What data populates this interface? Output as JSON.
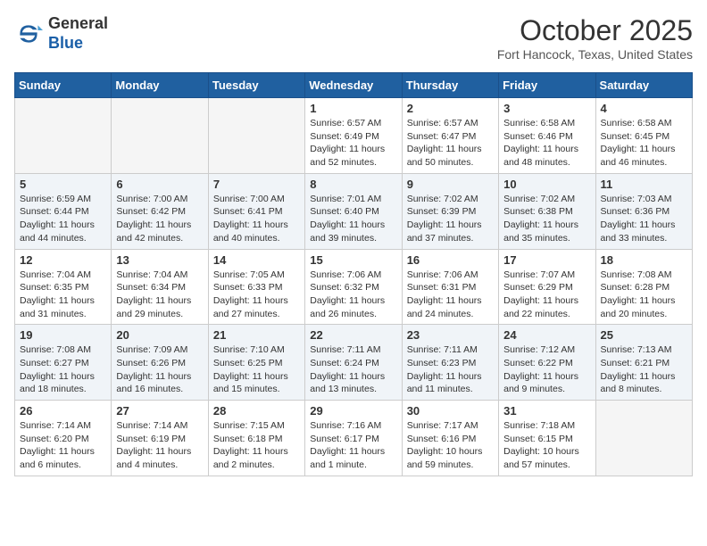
{
  "header": {
    "logo_line1": "General",
    "logo_line2": "Blue",
    "month": "October 2025",
    "location": "Fort Hancock, Texas, United States"
  },
  "weekdays": [
    "Sunday",
    "Monday",
    "Tuesday",
    "Wednesday",
    "Thursday",
    "Friday",
    "Saturday"
  ],
  "weeks": [
    [
      {
        "num": "",
        "sunrise": "",
        "sunset": "",
        "daylight": "",
        "empty": true
      },
      {
        "num": "",
        "sunrise": "",
        "sunset": "",
        "daylight": "",
        "empty": true
      },
      {
        "num": "",
        "sunrise": "",
        "sunset": "",
        "daylight": "",
        "empty": true
      },
      {
        "num": "1",
        "sunrise": "Sunrise: 6:57 AM",
        "sunset": "Sunset: 6:49 PM",
        "daylight": "Daylight: 11 hours and 52 minutes."
      },
      {
        "num": "2",
        "sunrise": "Sunrise: 6:57 AM",
        "sunset": "Sunset: 6:47 PM",
        "daylight": "Daylight: 11 hours and 50 minutes."
      },
      {
        "num": "3",
        "sunrise": "Sunrise: 6:58 AM",
        "sunset": "Sunset: 6:46 PM",
        "daylight": "Daylight: 11 hours and 48 minutes."
      },
      {
        "num": "4",
        "sunrise": "Sunrise: 6:58 AM",
        "sunset": "Sunset: 6:45 PM",
        "daylight": "Daylight: 11 hours and 46 minutes."
      }
    ],
    [
      {
        "num": "5",
        "sunrise": "Sunrise: 6:59 AM",
        "sunset": "Sunset: 6:44 PM",
        "daylight": "Daylight: 11 hours and 44 minutes."
      },
      {
        "num": "6",
        "sunrise": "Sunrise: 7:00 AM",
        "sunset": "Sunset: 6:42 PM",
        "daylight": "Daylight: 11 hours and 42 minutes."
      },
      {
        "num": "7",
        "sunrise": "Sunrise: 7:00 AM",
        "sunset": "Sunset: 6:41 PM",
        "daylight": "Daylight: 11 hours and 40 minutes."
      },
      {
        "num": "8",
        "sunrise": "Sunrise: 7:01 AM",
        "sunset": "Sunset: 6:40 PM",
        "daylight": "Daylight: 11 hours and 39 minutes."
      },
      {
        "num": "9",
        "sunrise": "Sunrise: 7:02 AM",
        "sunset": "Sunset: 6:39 PM",
        "daylight": "Daylight: 11 hours and 37 minutes."
      },
      {
        "num": "10",
        "sunrise": "Sunrise: 7:02 AM",
        "sunset": "Sunset: 6:38 PM",
        "daylight": "Daylight: 11 hours and 35 minutes."
      },
      {
        "num": "11",
        "sunrise": "Sunrise: 7:03 AM",
        "sunset": "Sunset: 6:36 PM",
        "daylight": "Daylight: 11 hours and 33 minutes."
      }
    ],
    [
      {
        "num": "12",
        "sunrise": "Sunrise: 7:04 AM",
        "sunset": "Sunset: 6:35 PM",
        "daylight": "Daylight: 11 hours and 31 minutes."
      },
      {
        "num": "13",
        "sunrise": "Sunrise: 7:04 AM",
        "sunset": "Sunset: 6:34 PM",
        "daylight": "Daylight: 11 hours and 29 minutes."
      },
      {
        "num": "14",
        "sunrise": "Sunrise: 7:05 AM",
        "sunset": "Sunset: 6:33 PM",
        "daylight": "Daylight: 11 hours and 27 minutes."
      },
      {
        "num": "15",
        "sunrise": "Sunrise: 7:06 AM",
        "sunset": "Sunset: 6:32 PM",
        "daylight": "Daylight: 11 hours and 26 minutes."
      },
      {
        "num": "16",
        "sunrise": "Sunrise: 7:06 AM",
        "sunset": "Sunset: 6:31 PM",
        "daylight": "Daylight: 11 hours and 24 minutes."
      },
      {
        "num": "17",
        "sunrise": "Sunrise: 7:07 AM",
        "sunset": "Sunset: 6:29 PM",
        "daylight": "Daylight: 11 hours and 22 minutes."
      },
      {
        "num": "18",
        "sunrise": "Sunrise: 7:08 AM",
        "sunset": "Sunset: 6:28 PM",
        "daylight": "Daylight: 11 hours and 20 minutes."
      }
    ],
    [
      {
        "num": "19",
        "sunrise": "Sunrise: 7:08 AM",
        "sunset": "Sunset: 6:27 PM",
        "daylight": "Daylight: 11 hours and 18 minutes."
      },
      {
        "num": "20",
        "sunrise": "Sunrise: 7:09 AM",
        "sunset": "Sunset: 6:26 PM",
        "daylight": "Daylight: 11 hours and 16 minutes."
      },
      {
        "num": "21",
        "sunrise": "Sunrise: 7:10 AM",
        "sunset": "Sunset: 6:25 PM",
        "daylight": "Daylight: 11 hours and 15 minutes."
      },
      {
        "num": "22",
        "sunrise": "Sunrise: 7:11 AM",
        "sunset": "Sunset: 6:24 PM",
        "daylight": "Daylight: 11 hours and 13 minutes."
      },
      {
        "num": "23",
        "sunrise": "Sunrise: 7:11 AM",
        "sunset": "Sunset: 6:23 PM",
        "daylight": "Daylight: 11 hours and 11 minutes."
      },
      {
        "num": "24",
        "sunrise": "Sunrise: 7:12 AM",
        "sunset": "Sunset: 6:22 PM",
        "daylight": "Daylight: 11 hours and 9 minutes."
      },
      {
        "num": "25",
        "sunrise": "Sunrise: 7:13 AM",
        "sunset": "Sunset: 6:21 PM",
        "daylight": "Daylight: 11 hours and 8 minutes."
      }
    ],
    [
      {
        "num": "26",
        "sunrise": "Sunrise: 7:14 AM",
        "sunset": "Sunset: 6:20 PM",
        "daylight": "Daylight: 11 hours and 6 minutes."
      },
      {
        "num": "27",
        "sunrise": "Sunrise: 7:14 AM",
        "sunset": "Sunset: 6:19 PM",
        "daylight": "Daylight: 11 hours and 4 minutes."
      },
      {
        "num": "28",
        "sunrise": "Sunrise: 7:15 AM",
        "sunset": "Sunset: 6:18 PM",
        "daylight": "Daylight: 11 hours and 2 minutes."
      },
      {
        "num": "29",
        "sunrise": "Sunrise: 7:16 AM",
        "sunset": "Sunset: 6:17 PM",
        "daylight": "Daylight: 11 hours and 1 minute."
      },
      {
        "num": "30",
        "sunrise": "Sunrise: 7:17 AM",
        "sunset": "Sunset: 6:16 PM",
        "daylight": "Daylight: 10 hours and 59 minutes."
      },
      {
        "num": "31",
        "sunrise": "Sunrise: 7:18 AM",
        "sunset": "Sunset: 6:15 PM",
        "daylight": "Daylight: 10 hours and 57 minutes."
      },
      {
        "num": "",
        "sunrise": "",
        "sunset": "",
        "daylight": "",
        "empty": true
      }
    ]
  ]
}
